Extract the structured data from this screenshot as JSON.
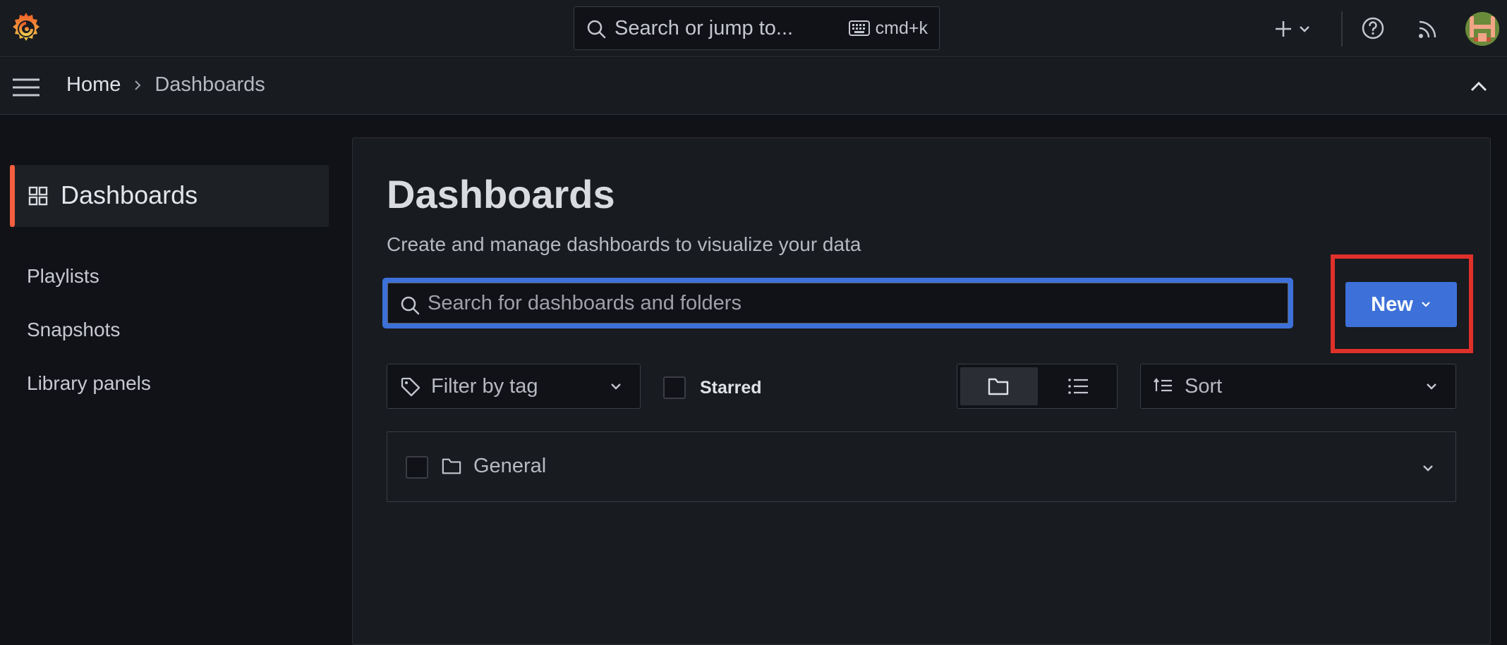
{
  "topbar": {
    "search_placeholder": "Search or jump to...",
    "search_shortcut": "cmd+k"
  },
  "breadcrumb": {
    "home": "Home",
    "current": "Dashboards"
  },
  "sidebar": {
    "active_label": "Dashboards",
    "items": [
      {
        "label": "Playlists"
      },
      {
        "label": "Snapshots"
      },
      {
        "label": "Library panels"
      }
    ]
  },
  "main": {
    "title": "Dashboards",
    "subtitle": "Create and manage dashboards to visualize your data",
    "search_placeholder": "Search for dashboards and folders",
    "new_button": "New",
    "filter_tag": "Filter by tag",
    "starred": "Starred",
    "sort": "Sort",
    "folders": [
      {
        "name": "General"
      }
    ]
  },
  "colors": {
    "accent": "#3d71d9",
    "brand": "#f55f3e",
    "highlight": "#e0302a"
  }
}
